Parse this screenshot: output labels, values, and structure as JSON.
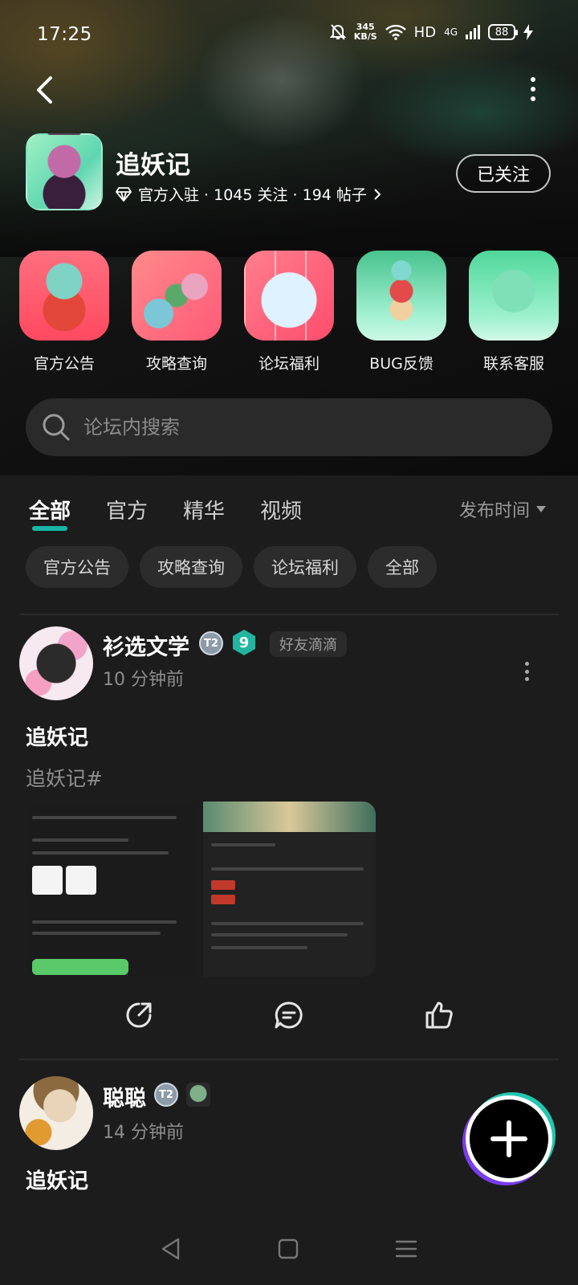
{
  "status": {
    "time": "17:25",
    "net_speed_value": "345",
    "net_speed_unit": "KB/S",
    "hd": "HD",
    "signal": "4G",
    "battery": "88"
  },
  "header": {
    "title": "追妖记",
    "meta": "官方入驻 · 1045 关注 · 194 帖子",
    "follow_label": "已关注"
  },
  "shortcuts": [
    {
      "label": "官方公告"
    },
    {
      "label": "攻略查询"
    },
    {
      "label": "论坛福利"
    },
    {
      "label": "BUG反馈"
    },
    {
      "label": "联系客服"
    }
  ],
  "search": {
    "placeholder": "论坛内搜索"
  },
  "tabs": [
    {
      "label": "全部",
      "active": true
    },
    {
      "label": "官方"
    },
    {
      "label": "精华"
    },
    {
      "label": "视频"
    }
  ],
  "sort_label": "发布时间",
  "chips": [
    "官方公告",
    "攻略查询",
    "论坛福利",
    "全部"
  ],
  "posts": [
    {
      "user": "衫选文学",
      "badge_t": "T2",
      "level": "9",
      "tag": "好友滴滴",
      "time": "10 分钟前",
      "title": "追妖记",
      "body": "追妖记#"
    },
    {
      "user": "聪聪",
      "badge_t": "T2",
      "time": "14 分钟前",
      "title": "追妖记"
    }
  ],
  "colors": {
    "accent": "#18b5a7",
    "background": "#1c1c1c",
    "chip_bg": "#2c2c2c"
  },
  "icons": [
    "back-icon",
    "more-icon",
    "diamond-icon",
    "chevron-right-icon",
    "search-icon",
    "share-icon",
    "comment-icon",
    "like-icon",
    "plus-icon",
    "nav-back-icon",
    "nav-home-icon",
    "nav-menu-icon"
  ]
}
